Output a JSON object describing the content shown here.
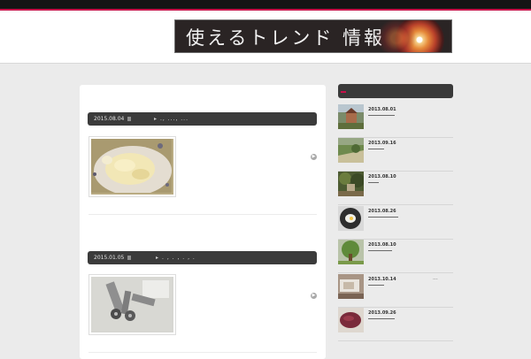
{
  "header": {
    "banner_text": "使えるトレンド 情報"
  },
  "posts": [
    {
      "date": "2015.08.04",
      "tags": "., ..., ...",
      "image": "cream-pasta-photo",
      "more_icon": "arrow-right-icon"
    },
    {
      "date": "2015.01.05",
      "tags": ". , . , . , .",
      "image": "bolts-photo",
      "more_icon": "arrow-right-icon"
    }
  ],
  "sidebar": {
    "items": [
      {
        "date": "2013.08.01",
        "image": "mountain-house-photo"
      },
      {
        "date": "2013.09.16",
        "image": "green-field-photo"
      },
      {
        "date": "2013.08.10",
        "image": "garden-photo"
      },
      {
        "date": "2013.08.26",
        "image": "frying-pan-photo"
      },
      {
        "date": "2013.08.10",
        "image": "tree-photo"
      },
      {
        "date": "2013.10.14",
        "image": "desk-photo"
      },
      {
        "date": "2013.09.26",
        "image": "sweet-potato-photo"
      }
    ],
    "ellipsis": "..."
  },
  "colors": {
    "accent": "#c8104a",
    "bar": "#3b3b3b",
    "background": "#ebebeb"
  }
}
